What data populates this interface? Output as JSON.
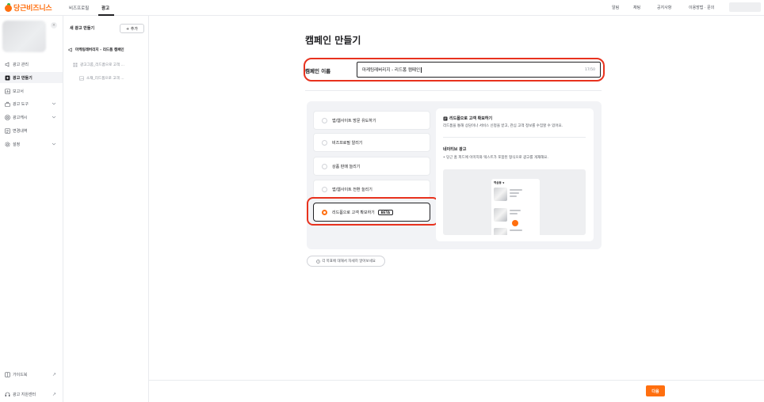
{
  "brand": {
    "name": "당근비즈니스",
    "color": "#ff6f0f"
  },
  "nav": {
    "tabs": [
      "비즈프로필",
      "광고"
    ],
    "active_tab": "광고",
    "links": [
      "알림",
      "채팅",
      "공지사항",
      "이용방법 · 문의"
    ]
  },
  "sidebar": {
    "items": [
      {
        "label": "광고 관리",
        "icon": "megaphone-icon",
        "active": false,
        "expandable": false
      },
      {
        "label": "광고 만들기",
        "icon": "plus-square-icon",
        "active": true,
        "expandable": false
      },
      {
        "label": "보고서",
        "icon": "report-icon",
        "active": false,
        "expandable": false
      },
      {
        "label": "광고 도구",
        "icon": "toolbox-icon",
        "active": false,
        "expandable": true
      },
      {
        "label": "광고캐시",
        "icon": "coin-icon",
        "active": false,
        "expandable": true
      },
      {
        "label": "변경내역",
        "icon": "history-icon",
        "active": false,
        "expandable": false
      },
      {
        "label": "설정",
        "icon": "gear-icon",
        "active": false,
        "expandable": true
      }
    ],
    "bottom": [
      {
        "label": "가이드북",
        "icon": "book-icon"
      },
      {
        "label": "광고 지원센터",
        "icon": "headset-icon"
      }
    ]
  },
  "tree": {
    "title": "새 광고 만들기",
    "add_label": "+ 추가",
    "nodes": [
      {
        "level": 0,
        "label": "마케팅레버리지 - 리드폼 캠페인",
        "icon": "megaphone-icon"
      },
      {
        "level": 1,
        "label": "광고그룹_리드폼으로 고객 ...",
        "icon": "grid-icon"
      },
      {
        "level": 2,
        "label": "소재_리드폼으로 고객 ...",
        "icon": "image-icon"
      }
    ]
  },
  "main": {
    "title": "캠페인 만들기",
    "name_label": "캠페인 이름",
    "name_value": "마케팅레버리지 - 리드폼 캠페인",
    "name_count": "17/50",
    "highlight_color": "#e8321e",
    "goals": [
      {
        "label": "앱/웹사이트 방문 유도하기",
        "selected": false,
        "badge": ""
      },
      {
        "label": "비즈프로필 알리기",
        "selected": false,
        "badge": ""
      },
      {
        "label": "상품 판매 늘리기",
        "selected": false,
        "badge": ""
      },
      {
        "label": "앱/웹사이트 전환 늘리기",
        "selected": false,
        "badge": ""
      },
      {
        "label": "리드폼으로 고객 확보하기",
        "selected": true,
        "badge": "BETA"
      }
    ],
    "preview": {
      "title": "리드폼으로 고객 확보하기",
      "description": "리드폼을 통해 상담이나 서비스 신청을 받고, 관심 고객 정보를 수집할 수 있어요.",
      "subtitle": "네이티브 광고",
      "bullet": "• 당근 홈 피드에 이미지와 텍스트가 포함된 형식으로 광고를 게재해요.",
      "phone_header": "역삼동 ∨"
    },
    "info_chip": "각 목표에 대해서 자세히 알아보세요"
  },
  "footer": {
    "next_label": "다음"
  }
}
